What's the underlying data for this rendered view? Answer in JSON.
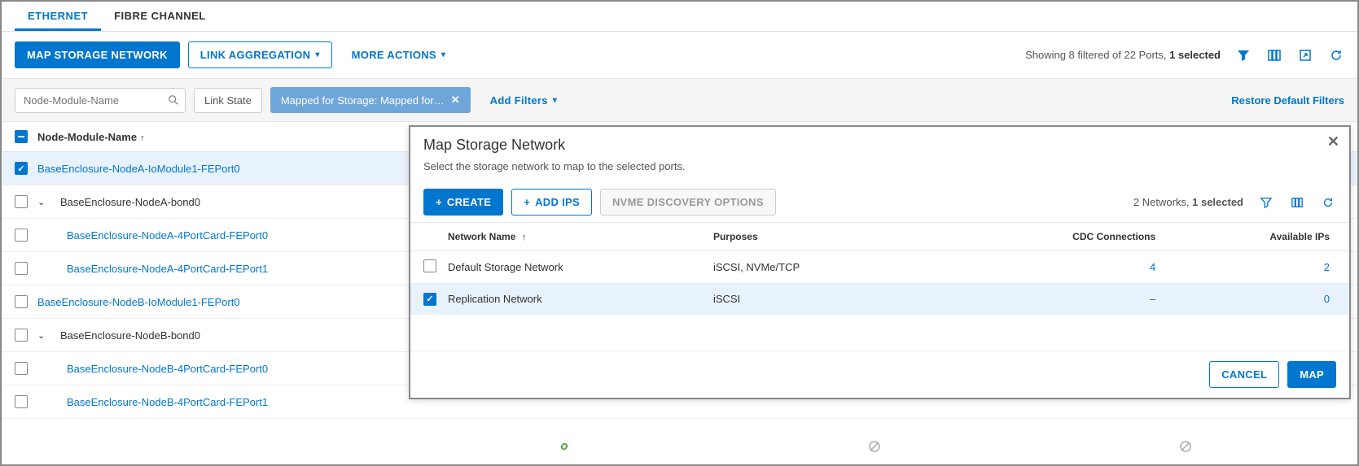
{
  "tabs": {
    "ethernet": "ETHERNET",
    "fibre": "FIBRE CHANNEL"
  },
  "toolbar": {
    "map_storage": "MAP STORAGE NETWORK",
    "link_agg": "LINK AGGREGATION",
    "more_actions": "MORE ACTIONS",
    "status_prefix": "Showing 8 filtered of 22 Ports, ",
    "status_suffix": "1 selected"
  },
  "filters": {
    "search_placeholder": "Node-Module-Name",
    "link_state": "Link State",
    "mapped_chip": "Mapped for Storage: Mapped for…",
    "add_filters": "Add Filters",
    "restore": "Restore Default Filters"
  },
  "table": {
    "header": "Node-Module-Name",
    "rows": [
      {
        "name": "BaseEnclosure-NodeA-IoModule1-FEPort0",
        "checked": true,
        "link": true,
        "indent": 0,
        "expand": ""
      },
      {
        "name": "BaseEnclosure-NodeA-bond0",
        "checked": false,
        "link": false,
        "indent": 0,
        "expand": "v"
      },
      {
        "name": "BaseEnclosure-NodeA-4PortCard-FEPort0",
        "checked": false,
        "link": true,
        "indent": 1,
        "expand": ""
      },
      {
        "name": "BaseEnclosure-NodeA-4PortCard-FEPort1",
        "checked": false,
        "link": true,
        "indent": 1,
        "expand": ""
      },
      {
        "name": "BaseEnclosure-NodeB-IoModule1-FEPort0",
        "checked": false,
        "link": true,
        "indent": 0,
        "expand": ""
      },
      {
        "name": "BaseEnclosure-NodeB-bond0",
        "checked": false,
        "link": false,
        "indent": 0,
        "expand": "v"
      },
      {
        "name": "BaseEnclosure-NodeB-4PortCard-FEPort0",
        "checked": false,
        "link": true,
        "indent": 1,
        "expand": ""
      },
      {
        "name": "BaseEnclosure-NodeB-4PortCard-FEPort1",
        "checked": false,
        "link": true,
        "indent": 1,
        "expand": ""
      }
    ]
  },
  "dialog": {
    "title": "Map Storage Network",
    "subtitle": "Select the storage network to map to the selected ports.",
    "create": "CREATE",
    "add_ips": "ADD IPS",
    "nvme": "NVME DISCOVERY OPTIONS",
    "status_prefix": "2 Networks, ",
    "status_suffix": "1 selected",
    "cols": {
      "name": "Network Name",
      "purposes": "Purposes",
      "cdc": "CDC Connections",
      "ips": "Available IPs"
    },
    "rows": [
      {
        "checked": false,
        "name": "Default Storage Network",
        "purposes": "iSCSI, NVMe/TCP",
        "cdc": "4",
        "ips": "2"
      },
      {
        "checked": true,
        "name": "Replication Network",
        "purposes": "iSCSI",
        "cdc": "–",
        "ips": "0"
      }
    ],
    "cancel": "CANCEL",
    "map": "MAP"
  }
}
